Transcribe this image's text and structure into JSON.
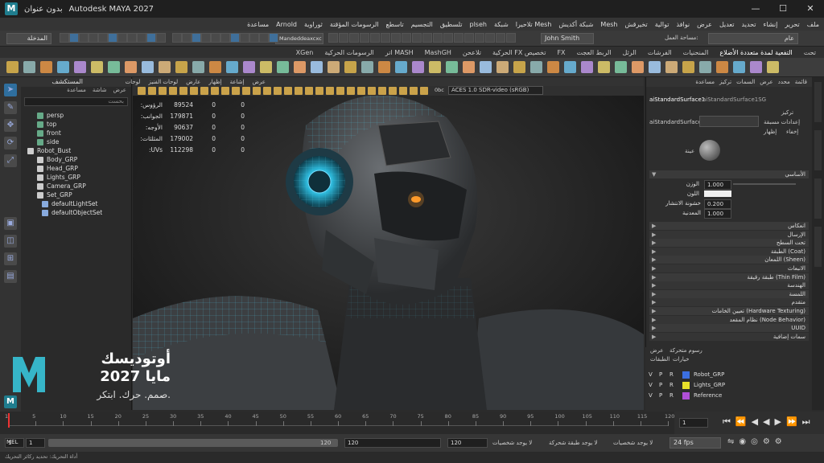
{
  "window": {
    "title": "Autodesk MAYA 2027",
    "tab_title": "بدون عنوان",
    "minimize": "—",
    "maximize": "☐",
    "close": "✕"
  },
  "menu": [
    "ملف",
    "تحرير",
    "إنشاء",
    "تحديد",
    "تعديل",
    "عرض",
    "نوافذ",
    "توالية",
    "تخيرقش",
    "Mesh",
    "شبكة أكديش",
    "Mesh تلاحيرا",
    "شبكة",
    "plseh",
    "تلسطيق",
    "التجسيم",
    "تاسطع",
    "الرسومات المؤقتة",
    "ثوراوية",
    "Arnold",
    "مساعدة"
  ],
  "status": {
    "mode": "المدخلة",
    "user": "John Smith",
    "workspace_label": "مساحة العمل:",
    "workspace": "عام",
    "snap_field": "Mandeddeaxcxc"
  },
  "shelf_tabs": [
    "تحت",
    "التفعية لمدة متعددة الأضلاع",
    "المنحنيات",
    "الفرشات",
    "الرثل",
    "الربط العجت",
    "FX",
    "تخصيص FX الحركية",
    "تلاعحن",
    "MashGH",
    "MASH اتر",
    "الرسومات الحركية",
    "XGen"
  ],
  "outliner": {
    "title": "المستكشف",
    "sub": [
      "عرض",
      "شاشة",
      "مساعدة"
    ],
    "search": "بحست",
    "items": [
      "persp",
      "top",
      "front",
      "side",
      "Robot_Bust",
      "Body_GRP",
      "Head_GRP",
      "Lights_GRP",
      "Camera_GRP",
      "Set_GRP",
      "defaultLightSet",
      "defaultObjectSet"
    ]
  },
  "viewport": {
    "menu": [
      "عرض",
      "إشاعة",
      "إظهار",
      "عارض",
      "لوحات الفنيز",
      "لوحات"
    ],
    "color_mgmt": "ACES 1.0 SDR-video (sRGB)",
    "gamma": "0bc"
  },
  "hud": [
    {
      "label": "الرؤوس:",
      "a": "89524",
      "b": "0",
      "c": "0"
    },
    {
      "label": "الجوانب:",
      "a": "179871",
      "b": "0",
      "c": "0"
    },
    {
      "label": "الأوجه:",
      "a": "90637",
      "b": "0",
      "c": "0"
    },
    {
      "label": "المثلثات:",
      "a": "179002",
      "b": "0",
      "c": "0"
    },
    {
      "label": "UVs:",
      "a": "112298",
      "b": "0",
      "c": "0"
    }
  ],
  "branding": {
    "line1": "أوتوديسك",
    "line2": "2027 مايا",
    "line3": "صمم. حرك. ابتكر."
  },
  "attr": {
    "tabs": [
      "قائمة",
      "محدد",
      "عرض",
      "السمات",
      "تركيز",
      "مساعدة"
    ],
    "node1": "aiStandardSurface1",
    "node2": "aiStandardSurface1SG",
    "node_label": "aiStandardSurface",
    "focus_btn": "تركيز",
    "presets_btn": "إعدادات مسبقة",
    "show_btn": "إظهار",
    "hide_btn": "إخفاء",
    "sample_label": "عينة",
    "section_base": "الأساسي",
    "weight_label": "الوزن",
    "weight": "1.000",
    "color_label": "اللون",
    "rough_label": "خشونة الانتشار",
    "rough": "0.200",
    "metal_label": "المعدنية",
    "metal": "1.000",
    "sections": [
      "انعكاس",
      "الإرسال",
      "تحت السطح",
      "(Coat) الطبقة",
      "(Sheen) اللمعان",
      "الانبعاث",
      "(Thin Film) طبقة رقيقة",
      "الهندسة",
      "اللمسة",
      "متقدم",
      "(Hardware Texturing) تعيين الخامات",
      "(Node Behavior) نظام المقعد",
      "UUID",
      "سمات إضافية"
    ]
  },
  "layers": {
    "tabs": [
      "عرض",
      "رسوم متحركة"
    ],
    "sub": [
      "خيارات",
      "الطبقات"
    ],
    "rows": [
      {
        "v": "V",
        "p": "P",
        "r": "R",
        "name": "Robot_GRP",
        "color": "#3b6fe0"
      },
      {
        "v": "V",
        "p": "P",
        "r": "R",
        "name": "Lights_GRP",
        "color": "#e8e02a"
      },
      {
        "v": "V",
        "p": "P",
        "r": "R",
        "name": "Reference",
        "color": "#b04fd8"
      }
    ]
  },
  "timeline": {
    "ticks": [
      "1",
      "5",
      "10",
      "15",
      "20",
      "25",
      "30",
      "35",
      "40",
      "45",
      "50",
      "55",
      "60",
      "65",
      "70",
      "75",
      "80",
      "85",
      "90",
      "95",
      "100",
      "105",
      "110",
      "115",
      "120"
    ],
    "current": "1"
  },
  "range": {
    "start": "1",
    "start2": "1",
    "end": "120",
    "end2": "120",
    "end3": "120",
    "no_char": "لا يوجد شخصيات",
    "no_anim": "لا يوجد طبقة شحركة",
    "no_char2": "لا يوجد شخصيات",
    "fps": "24 fps"
  },
  "cmd": {
    "lang": "MEL",
    "help": "أداة التحريك: تحديد ركائز التحريك"
  }
}
